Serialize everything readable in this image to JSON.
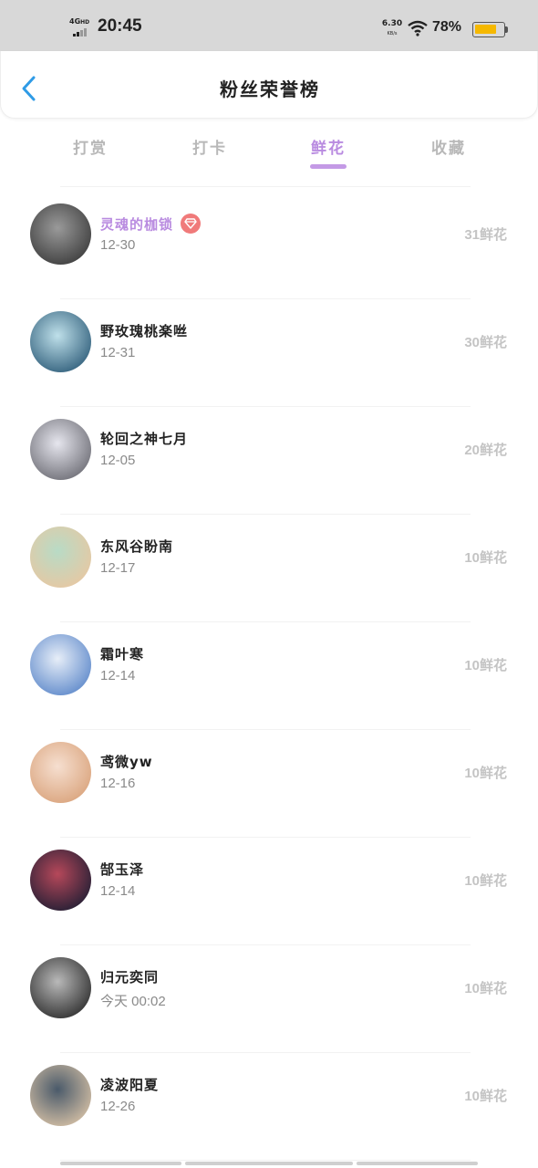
{
  "status_bar": {
    "network": "4G",
    "network_suffix": "HD",
    "time": "20:45",
    "speed": "6.30",
    "speed_unit": "KB/s",
    "battery": "78%",
    "battery_level": 0.78,
    "battery_color": "#f5b800"
  },
  "header": {
    "back_icon": "chevron-left-icon",
    "title": "粉丝荣誉榜"
  },
  "tabs": [
    {
      "label": "打赏",
      "active": false
    },
    {
      "label": "打卡",
      "active": false
    },
    {
      "label": "鲜花",
      "active": true
    },
    {
      "label": "收藏",
      "active": false
    }
  ],
  "accent_color": "#b98be0",
  "fans": [
    {
      "name": "灵魂的枷锁",
      "date": "12-30",
      "flowers": "31鲜花",
      "top": true,
      "badge": "diamond-icon",
      "avatar_colors": [
        "#3a3a3a",
        "#9a9a9a"
      ]
    },
    {
      "name": "野玫瑰桃楽咝",
      "date": "12-31",
      "flowers": "30鲜花",
      "top": false,
      "avatar_colors": [
        "#2c5b78",
        "#bfe0ea"
      ]
    },
    {
      "name": "轮回之神七月",
      "date": "12-05",
      "flowers": "20鲜花",
      "top": false,
      "avatar_colors": [
        "#6a6a72",
        "#e6e6ee"
      ]
    },
    {
      "name": "东风谷盼南",
      "date": "12-17",
      "flowers": "10鲜花",
      "top": false,
      "avatar_colors": [
        "#e9c7a1",
        "#b8dbc6"
      ]
    },
    {
      "name": "霜叶寒",
      "date": "12-14",
      "flowers": "10鲜花",
      "top": false,
      "avatar_colors": [
        "#5a86c9",
        "#e7eef8"
      ]
    },
    {
      "name": "鸢微yw",
      "date": "12-16",
      "flowers": "10鲜花",
      "top": false,
      "avatar_colors": [
        "#d9a27a",
        "#f6dfd0"
      ]
    },
    {
      "name": "郜玉泽",
      "date": "12-14",
      "flowers": "10鲜花",
      "top": false,
      "avatar_colors": [
        "#1d1d33",
        "#b6485a"
      ]
    },
    {
      "name": "归元奕同",
      "date": "今天 00:02",
      "flowers": "10鲜花",
      "top": false,
      "avatar_colors": [
        "#2a2a2a",
        "#b9b9b9"
      ]
    },
    {
      "name": "凌波阳夏",
      "date": "12-26",
      "flowers": "10鲜花",
      "top": false,
      "avatar_colors": [
        "#d9c3a7",
        "#4a5a6a"
      ]
    }
  ]
}
